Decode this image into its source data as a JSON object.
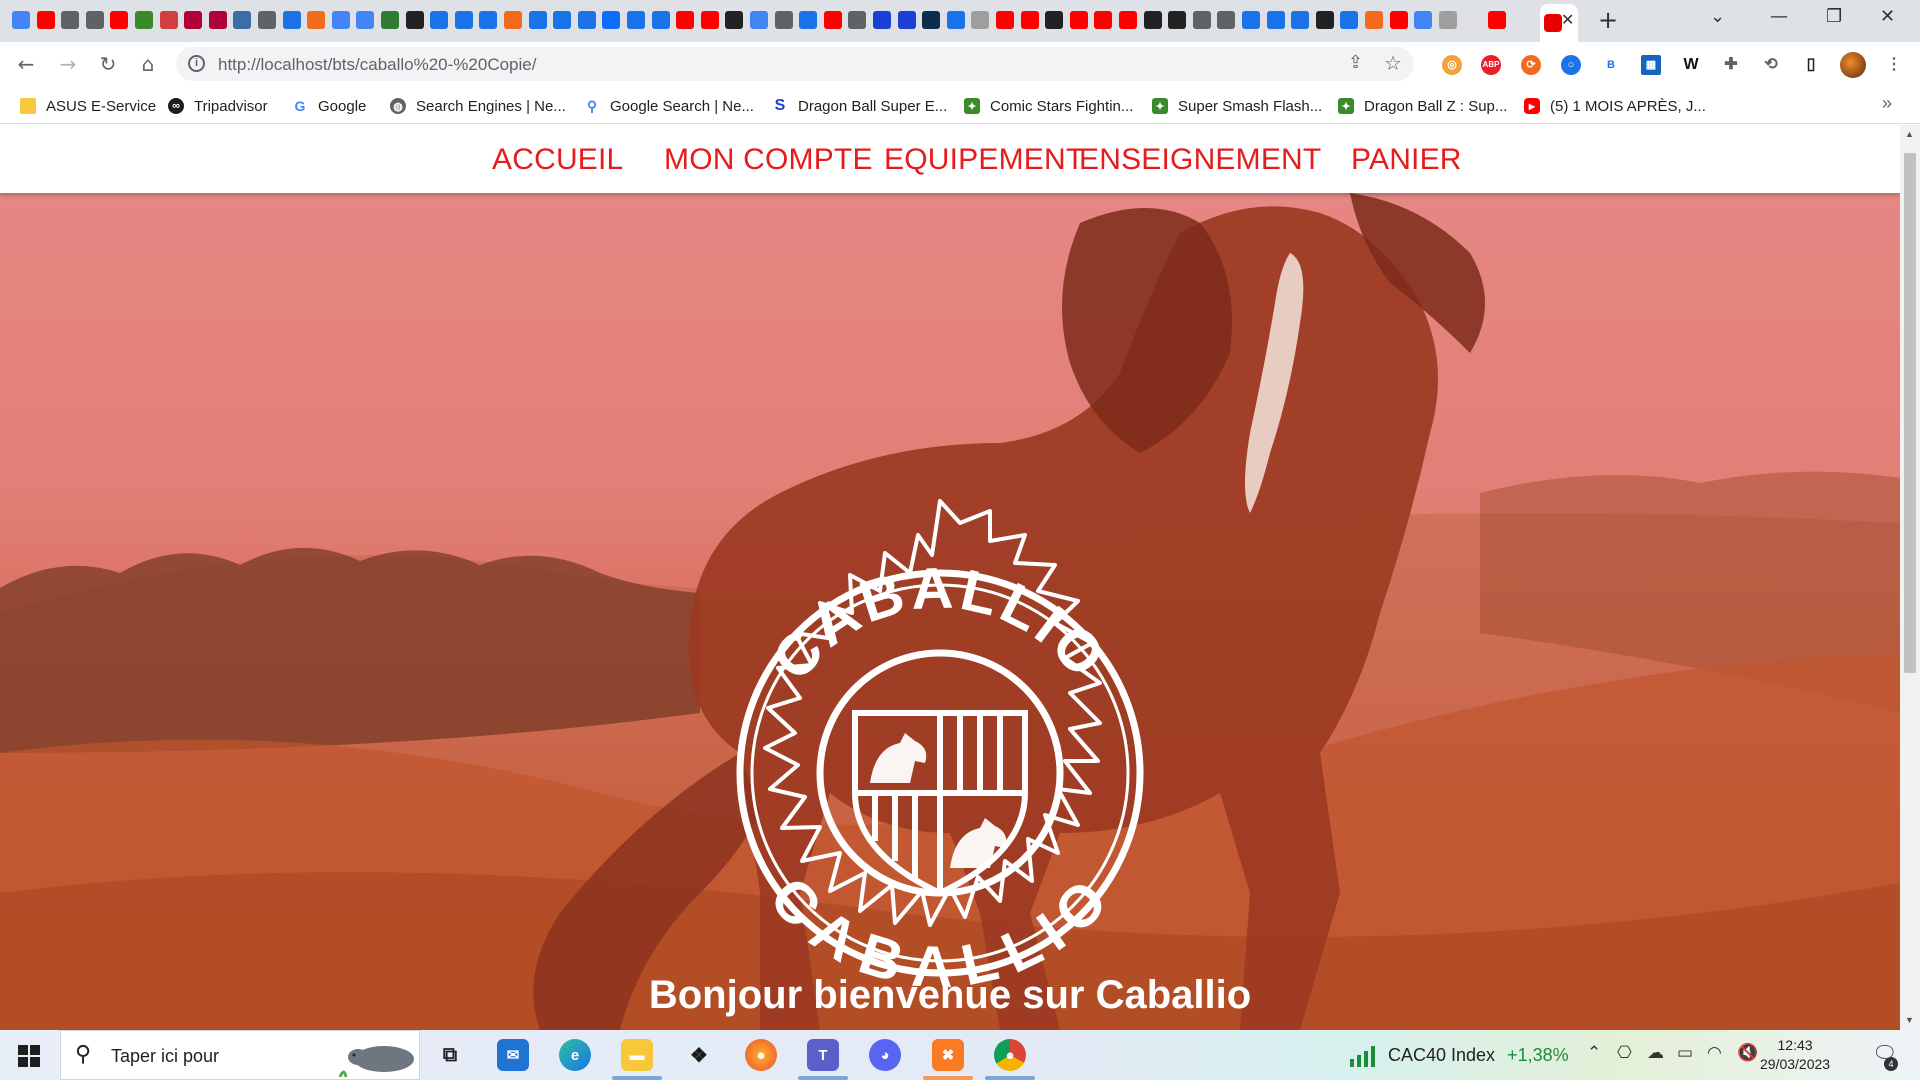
{
  "browser": {
    "url": "http://localhost/bts/caballo%20-%20Copie/",
    "bookmarks": [
      {
        "label": "ASUS E-Service",
        "icon": "folder-icon",
        "color": "#f6c83a"
      },
      {
        "label": "Tripadvisor",
        "icon": "tripadvisor-icon",
        "color": "#1e1e1e"
      },
      {
        "label": "Google",
        "icon": "google-icon",
        "color": "#4285f4"
      },
      {
        "label": "Search Engines | Ne...",
        "icon": "globe-icon",
        "color": "#5f6368"
      },
      {
        "label": "Google Search | Ne...",
        "icon": "search-icon",
        "color": "#4285f4"
      },
      {
        "label": "Dragon Ball Super E...",
        "icon": "s-logo-icon",
        "color": "#1a3fd6"
      },
      {
        "label": "Comic Stars Fightin...",
        "icon": "game-icon",
        "color": "#3a8a2b"
      },
      {
        "label": "Super Smash Flash...",
        "icon": "game-icon",
        "color": "#3a8a2b"
      },
      {
        "label": "Dragon Ball Z : Sup...",
        "icon": "game-icon",
        "color": "#3a8a2b"
      },
      {
        "label": "(5) 1 MOIS APRÈS, J...",
        "icon": "youtube-icon",
        "color": "#ff0000"
      }
    ]
  },
  "site": {
    "nav": [
      "ACCUEIL",
      "MON COMPTE",
      "EQUIPEMENT",
      "ENSEIGNEMENT",
      "PANIER"
    ],
    "logo_text_top": "CABALLIO",
    "logo_text_bottom": "CABALLIO",
    "welcome": "Bonjour bienvenue sur Caballio",
    "accent": "#e41c1c"
  },
  "taskbar": {
    "search_placeholder": "Taper ici pour",
    "apps": [
      "task-view-icon",
      "mail-icon",
      "edge-icon",
      "file-explorer-icon",
      "dropbox-icon",
      "firefox-icon",
      "teams-icon",
      "discord-icon",
      "xampp-icon",
      "chrome-icon"
    ],
    "stock_name": "CAC40 Index",
    "stock_change": "+1,38%",
    "time": "12:43",
    "date": "29/03/2023",
    "notifications": "4"
  }
}
